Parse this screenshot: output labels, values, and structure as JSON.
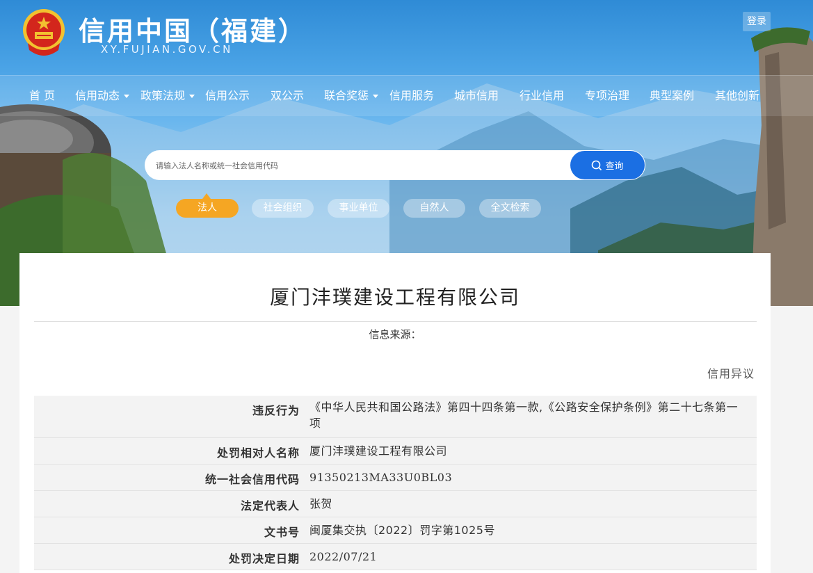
{
  "header": {
    "title": "信用中国（福建）",
    "subtitle": "XY.FUJIAN.GOV.CN",
    "login_label": "登录"
  },
  "nav": {
    "items": [
      {
        "label": "首 页",
        "dropdown": false
      },
      {
        "label": "信用动态",
        "dropdown": true
      },
      {
        "label": "政策法规",
        "dropdown": true
      },
      {
        "label": "信用公示",
        "dropdown": false
      },
      {
        "label": "双公示",
        "dropdown": false
      },
      {
        "label": "联合奖惩",
        "dropdown": true
      },
      {
        "label": "信用服务",
        "dropdown": false
      },
      {
        "label": "城市信用",
        "dropdown": false
      },
      {
        "label": "行业信用",
        "dropdown": false
      },
      {
        "label": "专项治理",
        "dropdown": false
      },
      {
        "label": "典型案例",
        "dropdown": false
      },
      {
        "label": "其他创新",
        "dropdown": false
      }
    ]
  },
  "search": {
    "placeholder": "请输入法人名称或统一社会信用代码",
    "button_label": "查询",
    "icon": "search-icon"
  },
  "tabs": [
    {
      "label": "法人",
      "active": true
    },
    {
      "label": "社会组织",
      "active": false
    },
    {
      "label": "事业单位",
      "active": false
    },
    {
      "label": "自然人",
      "active": false
    },
    {
      "label": "全文检索",
      "active": false
    }
  ],
  "detail": {
    "company_name": "厦门沣璞建设工程有限公司",
    "source_label": "信息来源：",
    "objection_label": "信用异议",
    "rows": [
      {
        "label": "违反行为",
        "value": "《中华人民共和国公路法》第四十四条第一款,《公路安全保护条例》第二十七条第一项"
      },
      {
        "label": "处罚相对人名称",
        "value": "厦门沣璞建设工程有限公司"
      },
      {
        "label": "统一社会信用代码",
        "value": "91350213MA33U0BL03"
      },
      {
        "label": "法定代表人",
        "value": "张贺"
      },
      {
        "label": "文书号",
        "value": "闽厦集交执〔2022〕罚字第1025号"
      },
      {
        "label": "处罚决定日期",
        "value": "2022/07/21"
      }
    ]
  },
  "colors": {
    "accent": "#1b6fe3",
    "active_tab": "#f5a623",
    "emblem_red": "#d3261c",
    "emblem_gold": "#f2c230"
  }
}
